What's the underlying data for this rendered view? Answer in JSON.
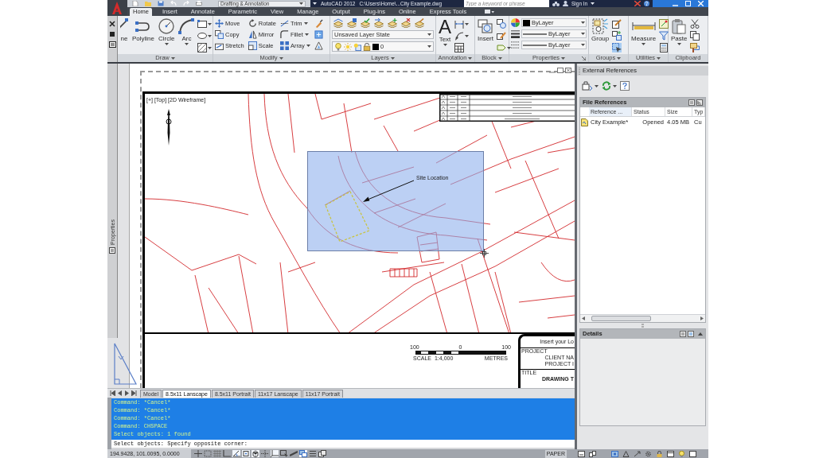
{
  "title_bar": {
    "workspace": "Drafting & Annotation",
    "app": "AutoCAD 2012",
    "file": "C:\\Users\\Home\\...City Example.dwg",
    "search": {
      "placeholder": "Type a keyword or phrase"
    },
    "sign_in": "Sign In"
  },
  "ribbon": {
    "tabs": [
      {
        "label": "Home",
        "selected": true
      },
      {
        "label": "Insert",
        "selected": false
      },
      {
        "label": "Annotate",
        "selected": false
      },
      {
        "label": "Parametric",
        "selected": false
      },
      {
        "label": "View",
        "selected": false
      },
      {
        "label": "Manage",
        "selected": false
      },
      {
        "label": "Output",
        "selected": false
      },
      {
        "label": "Plug-ins",
        "selected": false
      },
      {
        "label": "Online",
        "selected": false
      },
      {
        "label": "Express Tools",
        "selected": false
      }
    ],
    "panels": [
      {
        "kind": "tools",
        "title": "Draw",
        "menu": true,
        "items": [
          {
            "kind": "large",
            "label": "ne",
            "menu": false
          },
          {
            "kind": "large",
            "label": "Polyline",
            "menu": false
          },
          {
            "kind": "large",
            "label": "Circle",
            "menu": true
          },
          {
            "kind": "large",
            "label": "Arc",
            "menu": true
          },
          {
            "kind": "icon",
            "menu": true
          },
          {
            "kind": "icon",
            "menu": true
          },
          {
            "kind": "icon",
            "menu": true
          }
        ]
      },
      {
        "kind": "grid",
        "title": "Modify",
        "menu": true,
        "rows": [
          [
            {
              "kind": "small",
              "label": "Move",
              "menu": false
            },
            {
              "kind": "small",
              "label": "Rotate",
              "menu": false
            },
            {
              "kind": "small",
              "label": "Trim",
              "menu": true
            },
            {
              "kind": "icon",
              "menu": false
            }
          ],
          [
            {
              "kind": "small",
              "label": "Copy",
              "menu": false
            },
            {
              "kind": "small",
              "label": "Mirror",
              "menu": false
            },
            {
              "kind": "small",
              "label": "Fillet",
              "menu": true
            },
            {
              "kind": "icon",
              "menu": false
            }
          ],
          [
            {
              "kind": "small",
              "label": "Stretch",
              "menu": false
            },
            {
              "kind": "small",
              "label": "Scale",
              "menu": false
            },
            {
              "kind": "small",
              "label": "Array",
              "menu": true
            },
            {
              "kind": "icon",
              "menu": false
            }
          ]
        ]
      },
      {
        "kind": "layers",
        "title": "Layers",
        "menu": true,
        "state": "Unsaved Layer State",
        "layer": "0"
      },
      {
        "kind": "tools",
        "title": "Annotation",
        "menu": true,
        "items": [
          {
            "kind": "large",
            "label": "Text",
            "glyph": "A",
            "menu": true
          },
          {
            "kind": "icon",
            "menu": true
          },
          {
            "kind": "icon",
            "menu": true
          },
          {
            "kind": "icon",
            "menu": false
          }
        ]
      },
      {
        "kind": "tools",
        "title": "Block",
        "menu": true,
        "items": [
          {
            "kind": "large",
            "label": "Insert",
            "menu": false
          },
          {
            "kind": "icon",
            "menu": false
          },
          {
            "kind": "icon",
            "menu": false
          },
          {
            "kind": "icon",
            "menu": true
          }
        ]
      },
      {
        "kind": "properties",
        "title": "Properties",
        "menu": true,
        "settings": [
          "ByLayer",
          "ByLayer",
          "ByLayer"
        ]
      },
      {
        "kind": "tools",
        "title": "Groups",
        "menu": true,
        "items": [
          {
            "kind": "large",
            "label": "Group",
            "menu": false,
            "on": false
          },
          {
            "kind": "icon",
            "menu": false,
            "on": false
          },
          {
            "kind": "icon",
            "menu": false,
            "on": false
          },
          {
            "kind": "icon",
            "menu": false,
            "on": true
          }
        ]
      },
      {
        "kind": "tools",
        "title": "Utilities",
        "menu": true,
        "items": [
          {
            "kind": "large",
            "label": "Measure",
            "menu": true
          },
          {
            "kind": "icon",
            "menu": false
          },
          {
            "kind": "icon",
            "menu": false
          },
          {
            "kind": "icon",
            "menu": false
          }
        ]
      },
      {
        "kind": "tools",
        "title": "Clipboard",
        "menu": false,
        "items": [
          {
            "kind": "large",
            "label": "Paste",
            "menu": true
          },
          {
            "kind": "icon",
            "menu": false
          },
          {
            "kind": "icon",
            "menu": false
          },
          {
            "kind": "icon",
            "menu": false
          }
        ]
      }
    ]
  },
  "properties_palette": {
    "label": "Properties"
  },
  "viewport": {
    "label": "[+] [Top] [2D Wireframe]",
    "callout": "Site Location"
  },
  "title_block": {
    "scale_ticks": [
      "100",
      "0",
      "100"
    ],
    "scale_label": "SCALE",
    "scale": "1:4,000",
    "units": "METRES",
    "logo": "Insert your Lo",
    "project_label": "PROJECT",
    "project": [
      "CLIENT NA",
      "PROJECT I"
    ],
    "title_label": "TITLE",
    "title": "DRAWING T"
  },
  "layout_tabs": [
    {
      "label": "Model",
      "selected": false
    },
    {
      "label": "8.5x11 Lanscape",
      "selected": true
    },
    {
      "label": "8.5x11 Portrait",
      "selected": false
    },
    {
      "label": "11x17 Lanscape",
      "selected": false
    },
    {
      "label": "11x17 Portrait",
      "selected": false
    }
  ],
  "command_line": {
    "history": [
      "Command: *Cancel*",
      "Command: *Cancel*",
      "Command: *Cancel*",
      "Command: CHSPACE",
      "Select objects: 1 found"
    ],
    "prompt": "Select objects: Specify opposite corner:"
  },
  "external_references": {
    "title": "External References",
    "file_references": {
      "title": "File References",
      "columns": [
        "Reference ...",
        "Status",
        "Size",
        "Typ"
      ],
      "rows": [
        {
          "name": "City Example*",
          "status": "Opened",
          "size": "4.05 MB",
          "type": "Cu"
        }
      ]
    },
    "details": {
      "title": "Details"
    }
  },
  "status_bar": {
    "coordinates": "194.9428, 101.0095, 0.0000",
    "toggles": [
      {
        "on": false
      },
      {
        "on": false
      },
      {
        "on": false
      },
      {
        "on": false
      },
      {
        "on": true
      },
      {
        "on": true
      },
      {
        "on": true
      },
      {
        "on": false
      },
      {
        "on": true
      },
      {
        "on": false
      },
      {
        "on": false
      },
      {
        "on": true
      },
      {
        "on": false
      },
      {
        "on": false
      }
    ],
    "space": "PAPER"
  }
}
